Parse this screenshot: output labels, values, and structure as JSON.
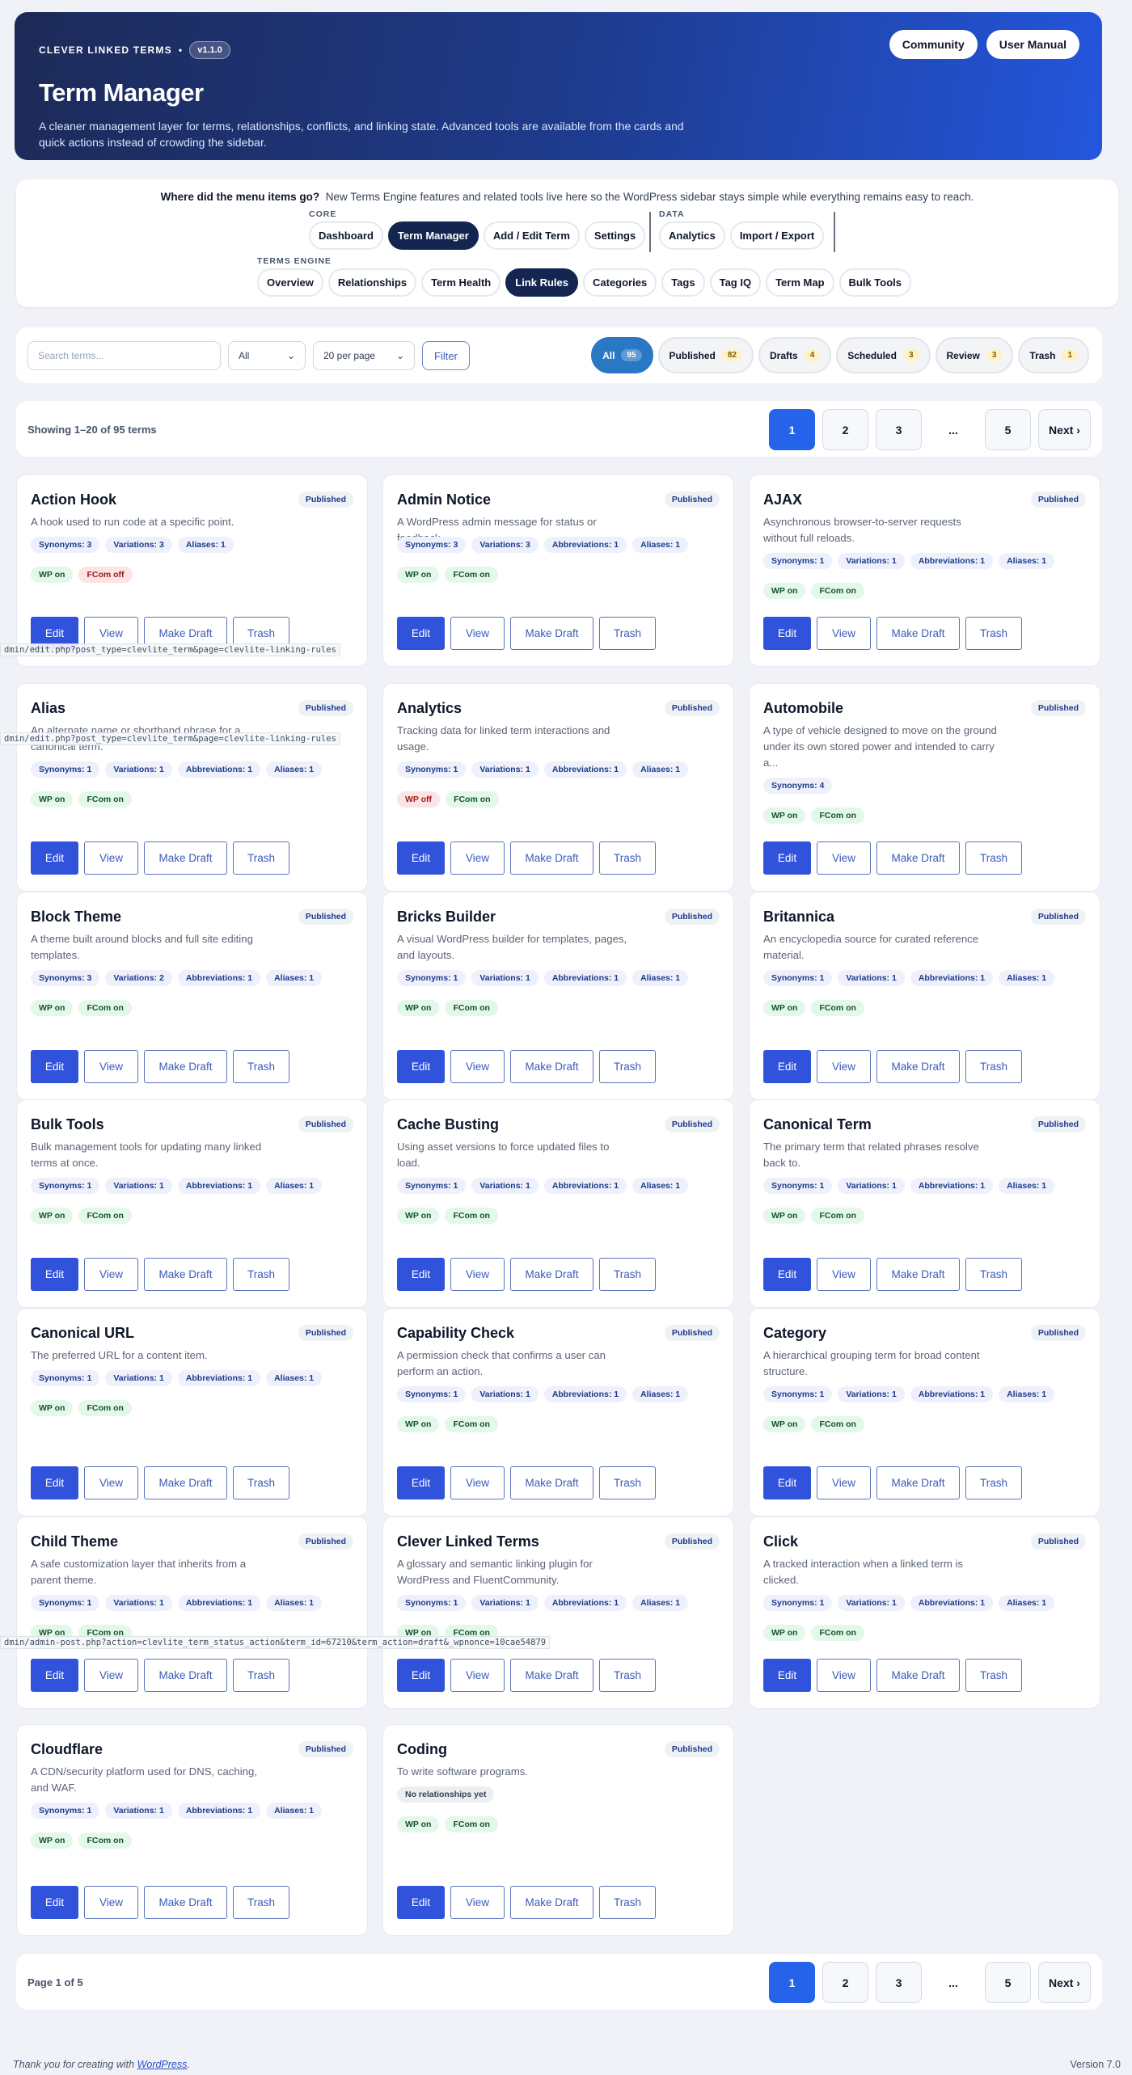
{
  "header": {
    "brand": "CLEVER LINKED TERMS",
    "dot": "•",
    "version": "v1.1.0",
    "title": "Term Manager",
    "description": "A cleaner management layer for terms, relationships, conflicts, and linking state. Advanced tools are available from the cards and quick actions instead of crowding the sidebar.",
    "buttons": [
      "Community",
      "User Manual"
    ]
  },
  "menu": {
    "note_bold": "Where did the menu items go?",
    "note_text": "New Terms Engine features and related tools live here so the WordPress sidebar stays simple while everything remains easy to reach.",
    "core_label": "CORE",
    "core": [
      "Dashboard",
      "Term Manager",
      "Add / Edit Term",
      "Settings"
    ],
    "data_label": "DATA",
    "data": [
      "Analytics",
      "Import / Export"
    ],
    "engine_label": "TERMS ENGINE",
    "engine": [
      "Overview",
      "Relationships",
      "Term Health",
      "Link Rules",
      "Categories",
      "Tags",
      "Tag IQ",
      "Term Map",
      "Bulk Tools"
    ]
  },
  "filters": {
    "search_placeholder": "Search terms...",
    "type": "All",
    "per_page": "20 per page",
    "filter_button": "Filter",
    "chevron": "⌄",
    "status": [
      {
        "label": "All",
        "count": "95"
      },
      {
        "label": "Published",
        "count": "82"
      },
      {
        "label": "Drafts",
        "count": "4"
      },
      {
        "label": "Scheduled",
        "count": "3"
      },
      {
        "label": "Review",
        "count": "3"
      },
      {
        "label": "Trash",
        "count": "1"
      }
    ]
  },
  "pagination": {
    "top_text": "Showing 1–20 of 95 terms",
    "bottom_text": "Page 1 of 5",
    "pages": [
      "1",
      "2",
      "3",
      "...",
      "5"
    ],
    "next": "Next ›"
  },
  "labels": {
    "published": "Published",
    "edit": "Edit",
    "view": "View",
    "draft": "Make Draft",
    "trash": "Trash",
    "no_rel": "No relationships yet"
  },
  "terms": [
    {
      "title": "Action Hook",
      "desc": "A hook used to run code at a specific point.",
      "rel": [
        "Synonyms: 3",
        "Variations: 3",
        "Aliases: 1"
      ],
      "wp": "WP on",
      "fcom": "FCom off"
    },
    {
      "title": "Admin Notice",
      "desc": "A WordPress admin message for status or feedback.",
      "rel": [
        "Synonyms: 3",
        "Variations: 3",
        "Abbreviations: 1",
        "Aliases: 1"
      ],
      "wp": "WP on",
      "fcom": "FCom on"
    },
    {
      "title": "AJAX",
      "desc": "Asynchronous browser-to-server requests without full reloads.",
      "rel": [
        "Synonyms: 1",
        "Variations: 1",
        "Abbreviations: 1",
        "Aliases: 1"
      ],
      "wp": "WP on",
      "fcom": "FCom on"
    },
    {
      "title": "Alias",
      "desc": "An alternate name or shorthand phrase for a canonical term.",
      "rel": [
        "Synonyms: 1",
        "Variations: 1",
        "Abbreviations: 1",
        "Aliases: 1"
      ],
      "wp": "WP on",
      "fcom": "FCom on"
    },
    {
      "title": "Analytics",
      "desc": "Tracking data for linked term interactions and usage.",
      "rel": [
        "Synonyms: 1",
        "Variations: 1",
        "Abbreviations: 1",
        "Aliases: 1"
      ],
      "wp": "WP off",
      "fcom": "FCom on"
    },
    {
      "title": "Automobile",
      "desc": "A type of vehicle designed to move on the ground under its own stored power and intended to carry a...",
      "rel": [
        "Synonyms: 4"
      ],
      "wp": "WP on",
      "fcom": "FCom on"
    },
    {
      "title": "Block Theme",
      "desc": "A theme built around blocks and full site editing templates.",
      "rel": [
        "Synonyms: 3",
        "Variations: 2",
        "Abbreviations: 1",
        "Aliases: 1"
      ],
      "wp": "WP on",
      "fcom": "FCom on"
    },
    {
      "title": "Bricks Builder",
      "desc": "A visual WordPress builder for templates, pages, and layouts.",
      "rel": [
        "Synonyms: 1",
        "Variations: 1",
        "Abbreviations: 1",
        "Aliases: 1"
      ],
      "wp": "WP on",
      "fcom": "FCom on"
    },
    {
      "title": "Britannica",
      "desc": "An encyclopedia source for curated reference material.",
      "rel": [
        "Synonyms: 1",
        "Variations: 1",
        "Abbreviations: 1",
        "Aliases: 1"
      ],
      "wp": "WP on",
      "fcom": "FCom on"
    },
    {
      "title": "Bulk Tools",
      "desc": "Bulk management tools for updating many linked terms at once.",
      "rel": [
        "Synonyms: 1",
        "Variations: 1",
        "Abbreviations: 1",
        "Aliases: 1"
      ],
      "wp": "WP on",
      "fcom": "FCom on"
    },
    {
      "title": "Cache Busting",
      "desc": "Using asset versions to force updated files to load.",
      "rel": [
        "Synonyms: 1",
        "Variations: 1",
        "Abbreviations: 1",
        "Aliases: 1"
      ],
      "wp": "WP on",
      "fcom": "FCom on"
    },
    {
      "title": "Canonical Term",
      "desc": "The primary term that related phrases resolve back to.",
      "rel": [
        "Synonyms: 1",
        "Variations: 1",
        "Abbreviations: 1",
        "Aliases: 1"
      ],
      "wp": "WP on",
      "fcom": "FCom on"
    },
    {
      "title": "Canonical URL",
      "desc": "The preferred URL for a content item.",
      "rel": [
        "Synonyms: 1",
        "Variations: 1",
        "Abbreviations: 1",
        "Aliases: 1"
      ],
      "wp": "WP on",
      "fcom": "FCom on"
    },
    {
      "title": "Capability Check",
      "desc": "A permission check that confirms a user can perform an action.",
      "rel": [
        "Synonyms: 1",
        "Variations: 1",
        "Abbreviations: 1",
        "Aliases: 1"
      ],
      "wp": "WP on",
      "fcom": "FCom on"
    },
    {
      "title": "Category",
      "desc": "A hierarchical grouping term for broad content structure.",
      "rel": [
        "Synonyms: 1",
        "Variations: 1",
        "Abbreviations: 1",
        "Aliases: 1"
      ],
      "wp": "WP on",
      "fcom": "FCom on"
    },
    {
      "title": "Child Theme",
      "desc": "A safe customization layer that inherits from a parent theme.",
      "rel": [
        "Synonyms: 1",
        "Variations: 1",
        "Abbreviations: 1",
        "Aliases: 1"
      ],
      "wp": "WP on",
      "fcom": "FCom on"
    },
    {
      "title": "Clever Linked Terms",
      "desc": "A glossary and semantic linking plugin for WordPress and FluentCommunity.",
      "rel": [
        "Synonyms: 1",
        "Variations: 1",
        "Abbreviations: 1",
        "Aliases: 1"
      ],
      "wp": "WP on",
      "fcom": "FCom on"
    },
    {
      "title": "Click",
      "desc": "A tracked interaction when a linked term is clicked.",
      "rel": [
        "Synonyms: 1",
        "Variations: 1",
        "Abbreviations: 1",
        "Aliases: 1"
      ],
      "wp": "WP on",
      "fcom": "FCom on"
    },
    {
      "title": "Cloudflare",
      "desc": "A CDN/security platform used for DNS, caching, and WAF.",
      "rel": [
        "Synonyms: 1",
        "Variations: 1",
        "Abbreviations: 1",
        "Aliases: 1"
      ],
      "wp": "WP on",
      "fcom": "FCom on"
    },
    {
      "title": "Coding",
      "desc": "To write software programs.",
      "rel": [],
      "wp": "WP on",
      "fcom": "FCom on"
    }
  ],
  "tooltips": [
    "dmin/edit.php?post_type=clevlite_term&page=clevlite-linking-rules",
    "dmin/edit.php?post_type=clevlite_term&page=clevlite-linking-rules",
    "dmin/admin-post.php?action=clevlite_term_status_action&term_id=67210&term_action=draft&_wpnonce=10cae54879"
  ],
  "footer": {
    "text": "Thank you for creating with",
    "link": "WordPress",
    "end": ".",
    "version": "Version 7.0"
  },
  "colors": {
    "hero_start": "#1d2a57",
    "hero_end": "#2456dd",
    "primary": "#3153dc",
    "active_nav": "#14264f",
    "status_active": "#2a78c4",
    "flag_on_bg": "#e3f8e8",
    "flag_off_bg": "#fde3e3"
  }
}
